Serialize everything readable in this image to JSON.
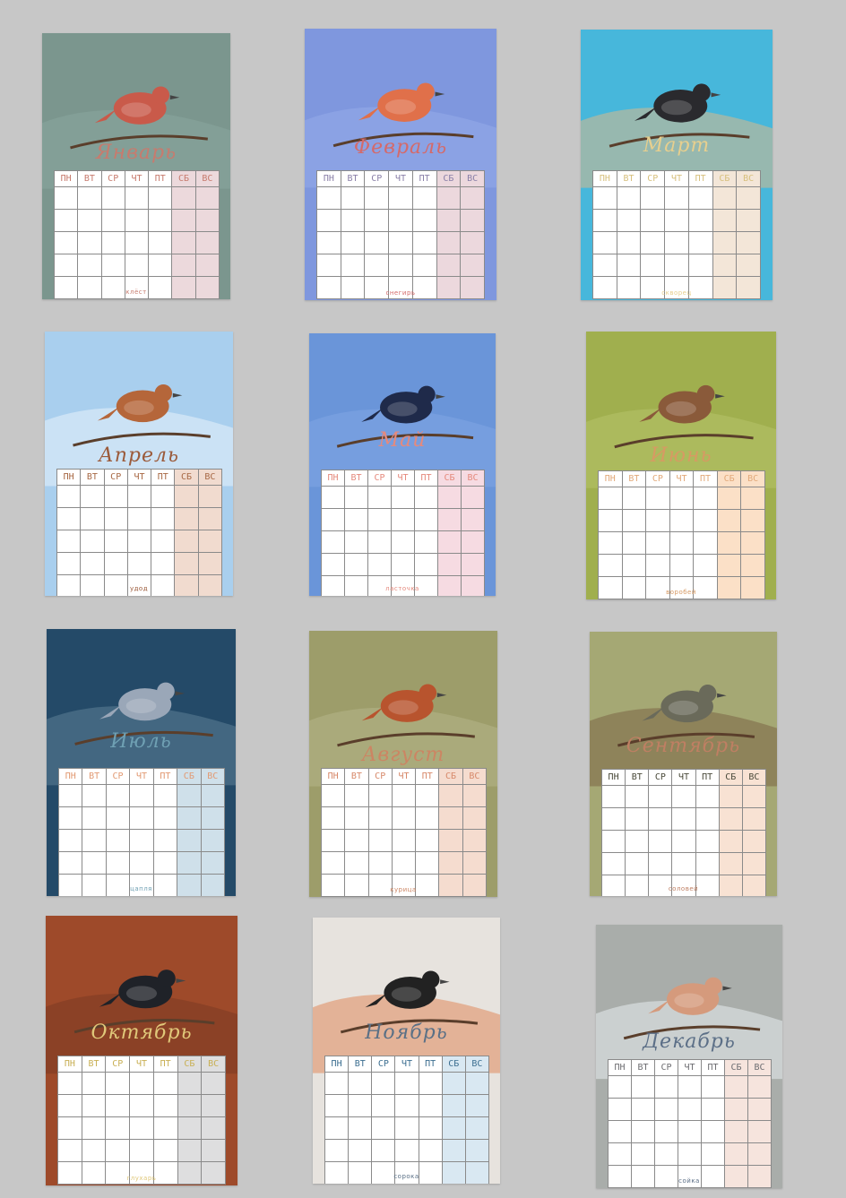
{
  "weekdays": [
    "ПН",
    "ВТ",
    "СР",
    "ЧТ",
    "ПТ",
    "СБ",
    "ВС"
  ],
  "months": [
    {
      "name": "Январь",
      "bird": "клёст",
      "bg": "#7b968e",
      "title_color": "#c77b6e",
      "head_color": "#c77b6e",
      "weekend": "#ecd9dc"
    },
    {
      "name": "Февраль",
      "bird": "снегирь",
      "bg": "#7f97de",
      "title_color": "#d46a6a",
      "head_color": "#8a80a8",
      "weekend": "#ecd8dd"
    },
    {
      "name": "Март",
      "bird": "скворец",
      "bg": "#47b7db",
      "title_color": "#e7cf8e",
      "head_color": "#d7c07e",
      "weekend": "#f3e6d8"
    },
    {
      "name": "Апрель",
      "bird": "удод",
      "bg": "#a9cfee",
      "title_color": "#9b5a3a",
      "head_color": "#a86945",
      "weekend": "#f1dbcf"
    },
    {
      "name": "Май",
      "bird": "ласточка",
      "bg": "#6a95d9",
      "title_color": "#e58a7d",
      "head_color": "#e58a7d",
      "weekend": "#f6dbe2"
    },
    {
      "name": "Июнь",
      "bird": "воробей",
      "bg": "#a0af4e",
      "title_color": "#d79a63",
      "head_color": "#e2a97a",
      "weekend": "#fbe0c7"
    },
    {
      "name": "Июль",
      "bird": "цапля",
      "bg": "#244a68",
      "title_color": "#6fa0b3",
      "head_color": "#e29a73",
      "weekend": "#cfe0ea"
    },
    {
      "name": "Август",
      "bird": "курица",
      "bg": "#9d9d6a",
      "title_color": "#cc8563",
      "head_color": "#d7896a",
      "weekend": "#f5dccf"
    },
    {
      "name": "Сентябрь",
      "bird": "соловей",
      "bg": "#a5a874",
      "title_color": "#bf7f63",
      "head_color": "#4a4a3a",
      "weekend": "#f8e2d3"
    },
    {
      "name": "Октябрь",
      "bird": "глухарь",
      "bg": "#9e4a2a",
      "title_color": "#e0c87a",
      "head_color": "#c9b055",
      "weekend": "#dededf"
    },
    {
      "name": "Ноябрь",
      "bird": "сорока",
      "bg": "#e7e3de",
      "title_color": "#5a7086",
      "head_color": "#3d6f91",
      "weekend": "#d9e8f2"
    },
    {
      "name": "Декабрь",
      "bird": "сойка",
      "bg": "#a9adaa",
      "title_color": "#5c6f87",
      "head_color": "#6e6e72",
      "weekend": "#f6e4dd"
    }
  ]
}
